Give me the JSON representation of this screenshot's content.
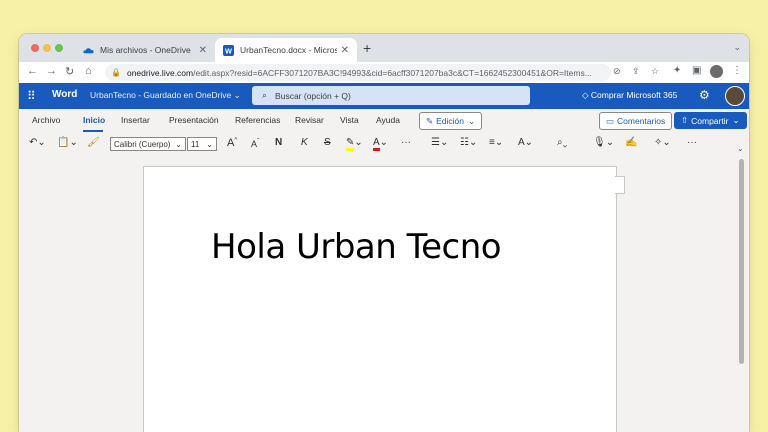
{
  "browser": {
    "tabs": [
      {
        "title": "Mis archivos - OneDrive",
        "icon": "onedrive-icon"
      },
      {
        "title": "UrbanTecno.docx - Microsoft W",
        "icon": "word-icon"
      }
    ],
    "url_host": "onedrive.live.com",
    "url_rest": "/edit.aspx?resid=6ACFF3071207BA3C!94993&cid=6acff3071207ba3c&CT=1662452300451&OR=Items..."
  },
  "word": {
    "app_name": "Word",
    "doc_title": "UrbanTecno - Guardado en OneDrive",
    "search_placeholder": "Buscar (opción + Q)",
    "buy_label": "Comprar Microsoft 365",
    "ribbon_tabs": [
      "Archivo",
      "Inicio",
      "Insertar",
      "Presentación",
      "Referencias",
      "Revisar",
      "Vista",
      "Ayuda"
    ],
    "active_tab": "Inicio",
    "mode_label": "Edición",
    "comments_label": "Comentarios",
    "share_label": "Compartir",
    "font_name": "Calibri (Cuerpo)",
    "font_size": "11",
    "toolbar": {
      "grow": "A",
      "shrink": "A",
      "bold": "N",
      "italic": "K",
      "strike": "S",
      "more": "···"
    },
    "document_text": "Hola Urban Tecno"
  },
  "colors": {
    "word_blue": "#185abd",
    "highlight_yellow": "#ffff00",
    "font_red": "#e81123"
  }
}
